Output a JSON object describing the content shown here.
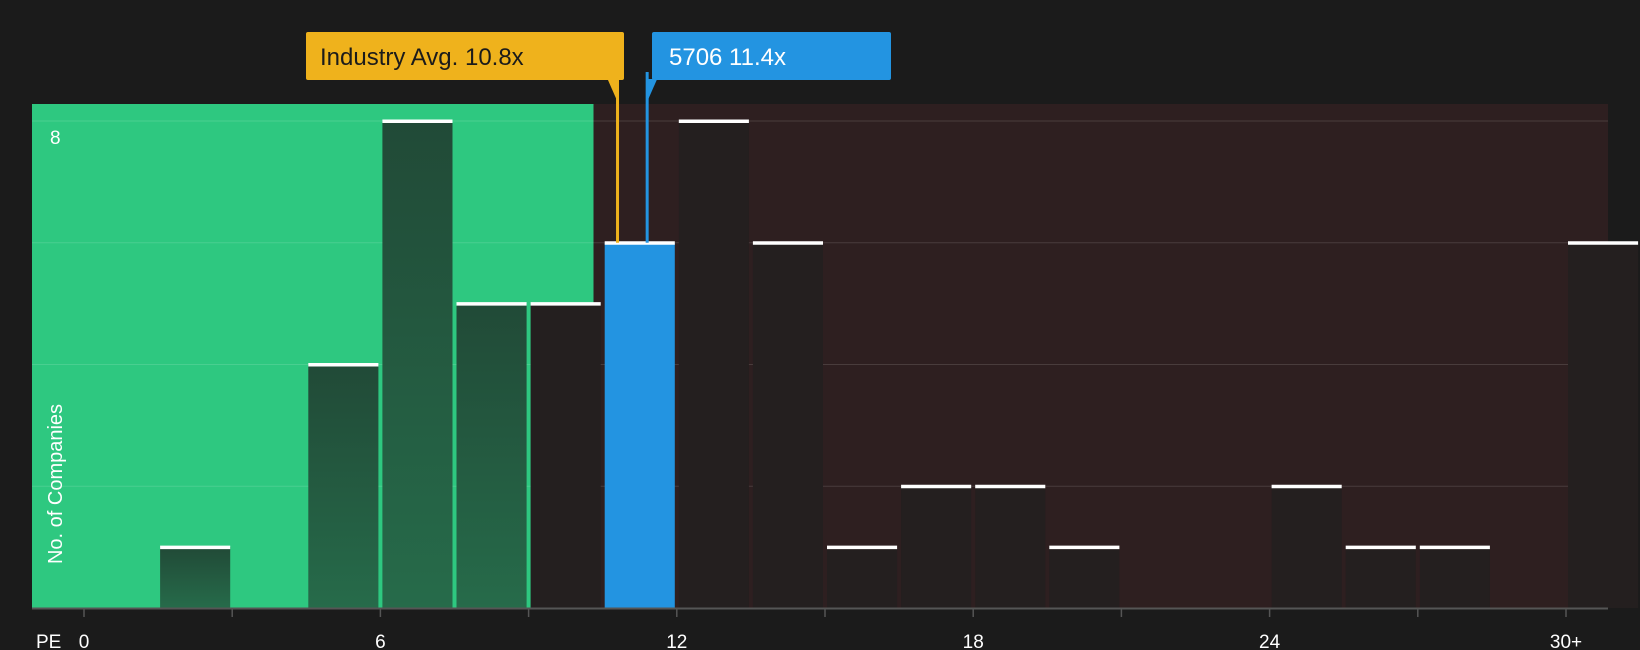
{
  "chart_data": {
    "type": "bar",
    "title": "",
    "xlabel": "PE",
    "ylabel": "No. of Companies",
    "xlim": [
      0,
      32
    ],
    "ylim": [
      0,
      8
    ],
    "y_max_tick_label": "8",
    "x_ticks": [
      {
        "value": 0,
        "label": "0"
      },
      {
        "value": 6,
        "label": "6"
      },
      {
        "value": 12,
        "label": "12"
      },
      {
        "value": 18,
        "label": "18"
      },
      {
        "value": 24,
        "label": "24"
      },
      {
        "value": 30,
        "label": "30+"
      }
    ],
    "bin_width": 1.5,
    "bins": [
      {
        "start": 1.5,
        "count": 1
      },
      {
        "start": 4.5,
        "count": 4
      },
      {
        "start": 6.0,
        "count": 8
      },
      {
        "start": 7.5,
        "count": 5
      },
      {
        "start": 9.0,
        "count": 5
      },
      {
        "start": 10.5,
        "count": 6,
        "highlight": true
      },
      {
        "start": 12.0,
        "count": 8
      },
      {
        "start": 13.5,
        "count": 6
      },
      {
        "start": 15.0,
        "count": 1
      },
      {
        "start": 16.5,
        "count": 2
      },
      {
        "start": 18.0,
        "count": 2
      },
      {
        "start": 19.5,
        "count": 1
      },
      {
        "start": 24.0,
        "count": 2
      },
      {
        "start": 25.5,
        "count": 1
      },
      {
        "start": 27.0,
        "count": 1
      },
      {
        "start": 30.0,
        "count": 6
      }
    ],
    "industry_avg": {
      "value": 10.8,
      "label": "Industry Avg. 10.8x"
    },
    "company": {
      "value": 11.4,
      "label": "5706 11.4x"
    },
    "colors": {
      "background": "#1b1b1b",
      "below_avg_region": "#2ec880",
      "above_avg_region": "#2e1f20",
      "bar_in_green": "#235a3e",
      "bar_in_red": "#241f1f",
      "company_bar": "#2394e1",
      "industry_callout": "#efb21c",
      "company_callout": "#2394e1",
      "bar_cap": "#ffffff",
      "axis": "#555555"
    }
  }
}
